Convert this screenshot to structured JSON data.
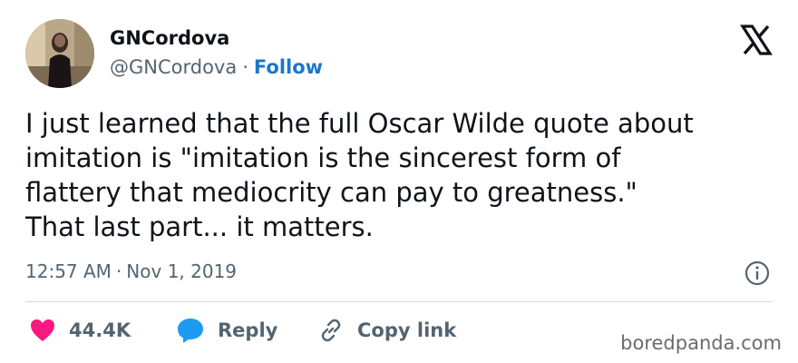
{
  "author": {
    "display_name": "GNCordova",
    "handle": "@GNCordova",
    "separator": "·",
    "follow_label": "Follow"
  },
  "platform": {
    "logo_icon": "x-logo-icon"
  },
  "tweet": {
    "text": "I just learned that the full Oscar Wilde quote about\nimitation is \"imitation is the sincerest form of\nflattery that mediocrity can pay to greatness.\"\nThat last part... it matters.",
    "time": "12:57 AM",
    "separator": "·",
    "date": "Nov 1, 2019"
  },
  "actions": {
    "likes_count": "44.4K",
    "reply_label": "Reply",
    "copy_link_label": "Copy link"
  },
  "watermark": {
    "text": "boredpanda.com"
  },
  "colors": {
    "accent": "#1d76c9",
    "like": "#f91880",
    "reply": "#1d9bf0",
    "muted": "#536471",
    "text": "#0f1419"
  }
}
